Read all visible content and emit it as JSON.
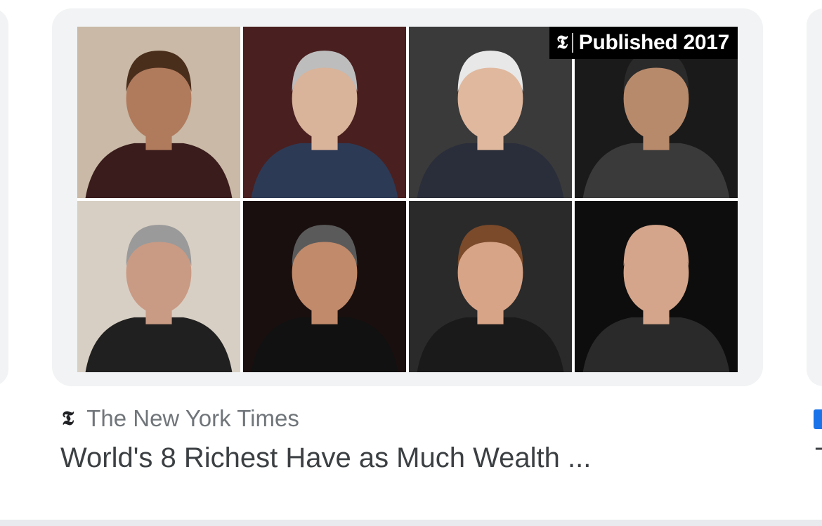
{
  "card": {
    "badge_text": "Published 2017",
    "badge_logo": "nyt-logo-icon",
    "source_name": "The New York Times",
    "source_logo": "nyt-logo-icon",
    "title": "World's 8 Richest Have as Much Wealth ..."
  },
  "next_card": {
    "title_fragment": "T"
  },
  "collage": {
    "tiles": [
      {
        "name": "portrait-1",
        "bg": "#c9b9a6",
        "suit": "#3a1c1c",
        "skin": "#b07a5c",
        "hair": "#4a2e1c"
      },
      {
        "name": "portrait-2",
        "bg": "#4a1f1f",
        "suit": "#2d3a55",
        "skin": "#d9b39a",
        "hair": "#bdbdbd"
      },
      {
        "name": "portrait-3",
        "bg": "#3a3a3a",
        "suit": "#2a2e3a",
        "skin": "#e0b89e",
        "hair": "#e8e8e8"
      },
      {
        "name": "portrait-4",
        "bg": "#1a1a1a",
        "suit": "#3a3a3a",
        "skin": "#b88a6c",
        "hair": "#2a2a2a"
      },
      {
        "name": "portrait-5",
        "bg": "#d8cfc4",
        "suit": "#202020",
        "skin": "#c99a84",
        "hair": "#9a9a9a"
      },
      {
        "name": "portrait-6",
        "bg": "#1a0f0f",
        "suit": "#111111",
        "skin": "#c18a6a",
        "hair": "#5a5a5a"
      },
      {
        "name": "portrait-7",
        "bg": "#2a2a2a",
        "suit": "#1a1a1a",
        "skin": "#d8a487",
        "hair": "#7a4a2a"
      },
      {
        "name": "portrait-8",
        "bg": "#0d0d0d",
        "suit": "#2a2a2a",
        "skin": "#d4a58a",
        "hair": "#d4a58a"
      }
    ]
  }
}
